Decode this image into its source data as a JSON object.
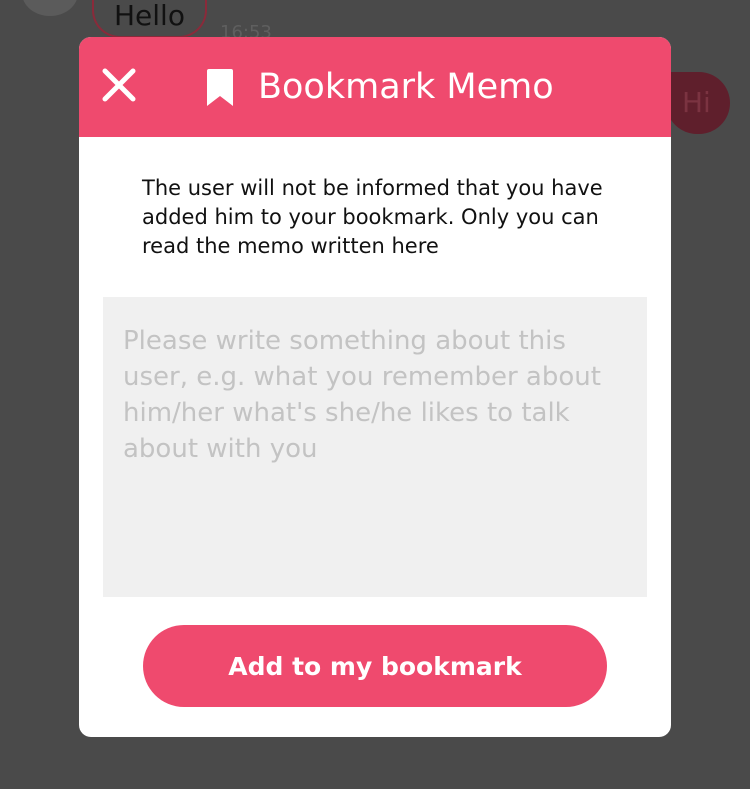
{
  "background_chat": {
    "incoming_message": "Hello",
    "incoming_time": "16:53",
    "outgoing_message": "Hi"
  },
  "modal": {
    "title": "Bookmark Memo",
    "description": "The user will not be informed that you have added him to your bookmark. Only you can read the memo written here",
    "memo": {
      "value": "",
      "placeholder": "Please write something about this user, e.g. what you remember about him/her what's she/he likes to talk about with you"
    },
    "add_button_label": "Add to my bookmark"
  },
  "icons": {
    "close": "close-icon",
    "bookmark": "bookmark-icon"
  },
  "colors": {
    "accent": "#ef4a6e",
    "overlay": "#4a4a4a",
    "input_background": "#f0f0f0"
  }
}
